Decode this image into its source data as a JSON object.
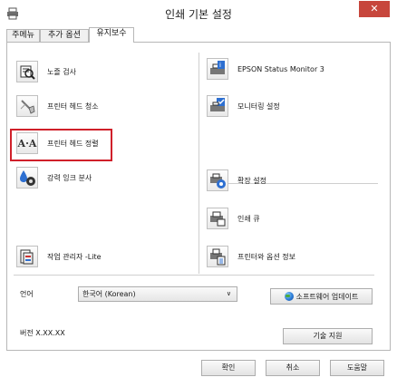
{
  "window": {
    "title": "인쇄 기본 설정",
    "close_glyph": "✕"
  },
  "tabs": [
    {
      "label": "주메뉴",
      "active": false
    },
    {
      "label": "추가 옵션",
      "active": false
    },
    {
      "label": "유지보수",
      "active": true
    }
  ],
  "left_items": [
    {
      "label": "노즐 검사",
      "icon": "nozzle-check-icon"
    },
    {
      "label": "프린터 헤드 청소",
      "icon": "head-cleaning-icon"
    },
    {
      "label": "프린터 헤드 정렬",
      "icon": "head-alignment-icon",
      "icon_text": "A·A"
    },
    {
      "label": "강력 잉크 분사",
      "icon": "power-ink-flushing-icon"
    },
    {
      "label": "작업 관리자 -Lite",
      "icon": "job-arranger-icon"
    }
  ],
  "right_items": [
    {
      "label": "EPSON Status Monitor 3",
      "icon": "status-monitor-icon"
    },
    {
      "label": "모니터링 설정",
      "icon": "monitoring-preferences-icon"
    },
    {
      "label": "확장 설정",
      "icon": "extended-settings-icon"
    },
    {
      "label": "인쇄 큐",
      "icon": "print-queue-icon"
    },
    {
      "label": "프린터와 옵션 정보",
      "icon": "printer-option-info-icon"
    }
  ],
  "language": {
    "label": "언어",
    "value": "한국어 (Korean)",
    "arrow": "∨"
  },
  "software_update": {
    "label": "소프트웨어 업데이트",
    "icon": "globe-icon"
  },
  "version": {
    "text": "버전 X.XX.XX"
  },
  "tech_support": {
    "label": "기술 지원"
  },
  "buttons": {
    "ok": "확인",
    "cancel": "취소",
    "help": "도움말"
  },
  "colors": {
    "close": "#c7463c",
    "highlight": "#d0202a"
  }
}
